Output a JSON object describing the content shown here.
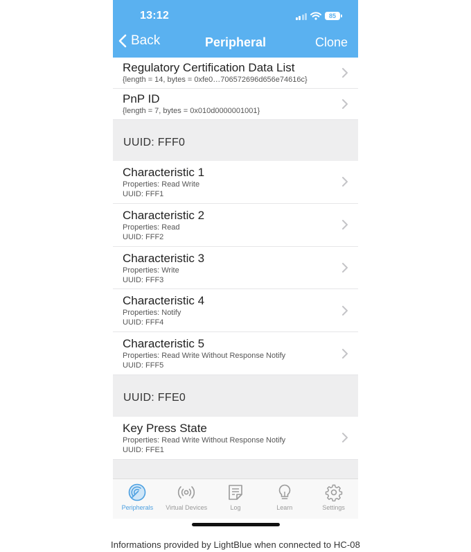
{
  "status_bar": {
    "time": "13:12",
    "battery": "85"
  },
  "nav": {
    "back_label": "Back",
    "title": "Peripheral",
    "clone_label": "Clone"
  },
  "top_rows": [
    {
      "title": "Regulatory Certification Data List",
      "subtitle": "{length = 14, bytes = 0xfe0…706572696d656e74616c}"
    },
    {
      "title": "PnP ID",
      "subtitle": "{length = 7, bytes = 0x010d0000001001}"
    }
  ],
  "services": [
    {
      "header": "UUID: FFF0",
      "characteristics": [
        {
          "title": "Characteristic 1",
          "properties": "Properties: Read Write",
          "uuid": "UUID: FFF1"
        },
        {
          "title": "Characteristic 2",
          "properties": "Properties: Read",
          "uuid": "UUID: FFF2"
        },
        {
          "title": "Characteristic 3",
          "properties": "Properties: Write",
          "uuid": "UUID: FFF3"
        },
        {
          "title": "Characteristic 4",
          "properties": "Properties: Notify",
          "uuid": "UUID: FFF4"
        },
        {
          "title": "Characteristic 5",
          "properties": "Properties: Read Write Without Response Notify",
          "uuid": "UUID: FFF5"
        }
      ]
    },
    {
      "header": "UUID: FFE0",
      "characteristics": [
        {
          "title": "Key Press State",
          "properties": "Properties: Read Write Without Response Notify",
          "uuid": "UUID: FFE1"
        }
      ]
    }
  ],
  "tabbar": {
    "active": "peripherals",
    "tabs": [
      {
        "label": "Peripherals",
        "icon": "radar-icon"
      },
      {
        "label": "Virtual Devices",
        "icon": "broadcast-icon"
      },
      {
        "label": "Log",
        "icon": "log-icon"
      },
      {
        "label": "Learn",
        "icon": "lightbulb-icon"
      },
      {
        "label": "Settings",
        "icon": "gear-icon"
      }
    ]
  },
  "caption": "Informations provided by LightBlue when connected to HC-08",
  "colors": {
    "header": "#5ab1f0",
    "active_tab": "#4b9fe0",
    "section_bg": "#eeeeef"
  }
}
